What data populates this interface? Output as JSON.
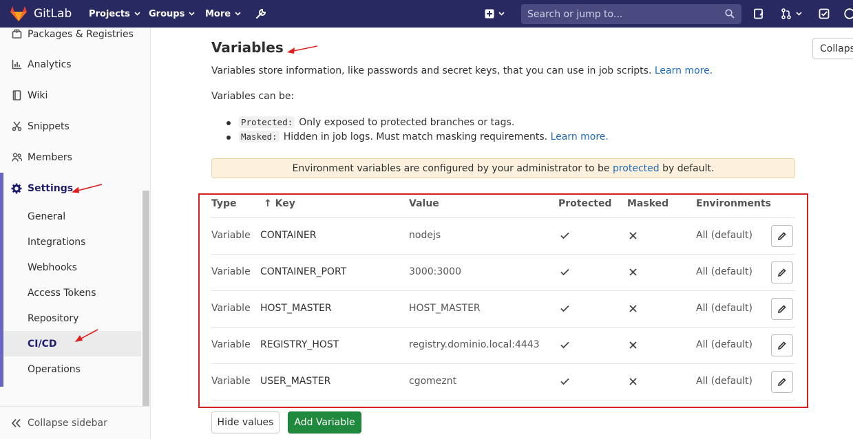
{
  "navbar": {
    "brand": "GitLab",
    "links": [
      {
        "label": "Projects"
      },
      {
        "label": "Groups"
      },
      {
        "label": "More"
      }
    ],
    "search_placeholder": "Search or jump to..."
  },
  "sidebar": {
    "items": [
      {
        "label": "Packages & Registries",
        "icon": "package-icon"
      },
      {
        "label": "Analytics",
        "icon": "chart-icon"
      },
      {
        "label": "Wiki",
        "icon": "book-icon"
      },
      {
        "label": "Snippets",
        "icon": "scissors-icon"
      },
      {
        "label": "Members",
        "icon": "users-icon"
      },
      {
        "label": "Settings",
        "icon": "gear-icon"
      }
    ],
    "settings_sub": [
      {
        "label": "General"
      },
      {
        "label": "Integrations"
      },
      {
        "label": "Webhooks"
      },
      {
        "label": "Access Tokens"
      },
      {
        "label": "Repository"
      },
      {
        "label": "CI/CD"
      },
      {
        "label": "Operations"
      }
    ],
    "collapse_label": "Collapse sidebar"
  },
  "main": {
    "title": "Variables",
    "collapse_button": "Collaps",
    "description": "Variables store information, like passwords and secret keys, that you can use in job scripts.",
    "learn_more": "Learn more.",
    "can_be": "Variables can be:",
    "bullets": [
      {
        "code": "Protected:",
        "text": "Only exposed to protected branches or tags.",
        "link": ""
      },
      {
        "code": "Masked:",
        "text": "Hidden in job logs. Must match masking requirements.",
        "link": "Learn more."
      }
    ],
    "alert_prefix": "Environment variables are configured by your administrator to be",
    "alert_link": "protected",
    "alert_suffix": "by default.",
    "table": {
      "headers": [
        "Type",
        "↑ Key",
        "Value",
        "Protected",
        "Masked",
        "Environments"
      ],
      "rows": [
        {
          "type": "Variable",
          "key": "CONTAINER",
          "value": "nodejs",
          "environments": "All (default)"
        },
        {
          "type": "Variable",
          "key": "CONTAINER_PORT",
          "value": "3000:3000",
          "environments": "All (default)"
        },
        {
          "type": "Variable",
          "key": "HOST_MASTER",
          "value": "HOST_MASTER",
          "environments": "All (default)"
        },
        {
          "type": "Variable",
          "key": "REGISTRY_HOST",
          "value": "registry.dominio.local:4443",
          "environments": "All (default)"
        },
        {
          "type": "Variable",
          "key": "USER_MASTER",
          "value": "cgomeznt",
          "environments": "All (default)"
        }
      ]
    },
    "hide_values_button": "Hide values",
    "add_variable_button": "Add Variable"
  },
  "colors": {
    "navbar": "#292961",
    "link": "#1f6bb5",
    "success": "#1f8a3d",
    "annotation_red": "#d9201f"
  }
}
